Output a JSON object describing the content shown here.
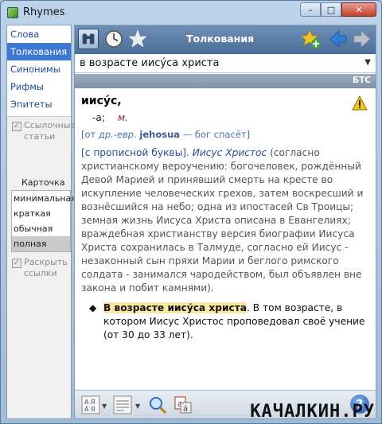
{
  "window": {
    "title": "Rhymes",
    "min_label": "–",
    "max_label": "□",
    "close_label": "✕"
  },
  "sidebar": {
    "items": [
      {
        "label": "Слова"
      },
      {
        "label": "Толкования"
      },
      {
        "label": "Синонимы"
      },
      {
        "label": "Рифмы"
      },
      {
        "label": "Эпитеты"
      }
    ],
    "links_option": {
      "line1": "Ссылочные",
      "line2": "статьи"
    },
    "card_title": "Карточка",
    "card_options": [
      "минимальная",
      "краткая",
      "обычная",
      "полная"
    ],
    "wrap_option": {
      "line1": "Раскрыть",
      "line2": "ссылки"
    }
  },
  "toolbar": {
    "title": "Толкования"
  },
  "search": {
    "value": "в возрасте иису́са христа"
  },
  "source": {
    "label": "БТС"
  },
  "entry": {
    "headword": "иису́с",
    "form_suffix": "-а;",
    "gram_label": "м.",
    "etym_open": "[от ",
    "etym_lang": "др.-евр.",
    "etym_word": "jehosua",
    "etym_rest": " — бог спасёт]",
    "def_note": "[с прописной буквы].",
    "def_name": "Иисус Христос",
    "def_text": " (согласно христианскому вероучению: богочеловек, рождённый Девой Марией и принявший смерть на кресте во искупление человеческих грехов, затем воскресший и вознёсшийся на небо; одна из ипостасей Св Троицы; земная жизнь Иисуса Христа описана в Евангелиях; враждебная христианству версия биографии Иисуса Христа сохранилась в Талмуде, согласно ей Иисус - незаконный сын пряхи Марии и беглого римского солдата - занимался чародейством, был объявлен вне закона и побит камнями).",
    "phrase_bullet": "◆",
    "phrase_head": "В возрасте иису́са христа",
    "phrase_text": ". В том возрасте, в котором Иисус Христос проповедовал своё учение (от 30 до 33 лет)."
  },
  "help_label": "?",
  "watermark": "КАЧАЛКИН.РУ",
  "colors": {
    "accent": "#3c78d2",
    "toolbar": "#5a7ea8",
    "highlight": "#fbe7a4",
    "link": "#2a4a9a"
  }
}
